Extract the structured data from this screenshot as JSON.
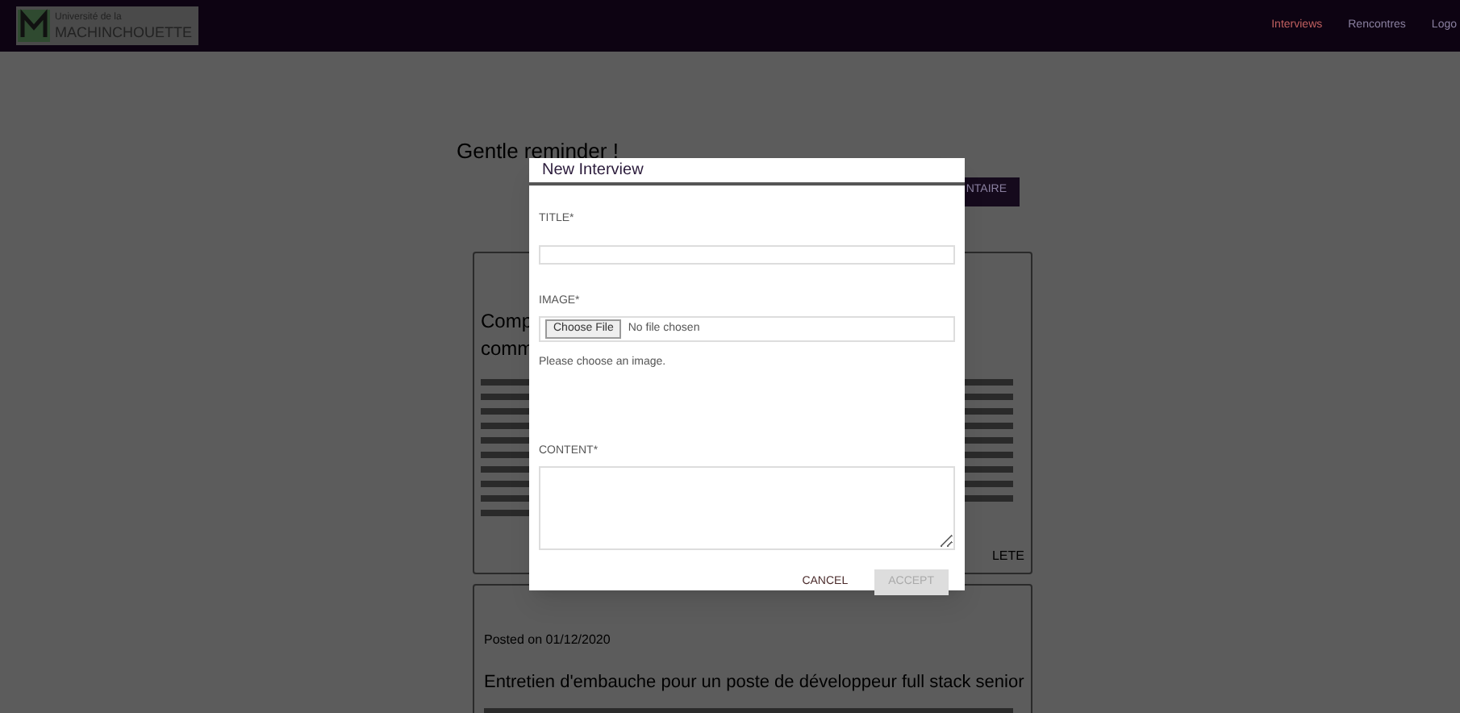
{
  "header": {
    "logo_line_1": "Université de la",
    "logo_line_2": "MACHINCHOUETTE",
    "nav": [
      {
        "label": "Interviews",
        "selected": true
      },
      {
        "label": "Rencontres",
        "selected": false
      },
      {
        "label": "Logo",
        "selected": false
      }
    ]
  },
  "page": {
    "title": "Gentle reminder !",
    "reminder_button": "NTAIRE",
    "cards": [
      {
        "title_lines": [
          "Comp",
          "comm"
        ],
        "action": "LETE"
      },
      {
        "meta": "Posted on 01/12/2020",
        "title": "Entretien d'embauche pour un poste de développeur full stack senior"
      }
    ]
  },
  "modal": {
    "title": "New Interview",
    "fields": [
      {
        "kind": "text",
        "label": "TITLE*"
      },
      {
        "kind": "file",
        "label": "IMAGE*",
        "button": "Choose File",
        "value": "No file chosen",
        "hint": "Please choose an image."
      },
      {
        "kind": "textarea",
        "label": "CONTENT*"
      }
    ],
    "buttons": [
      {
        "label": "CANCEL",
        "disabled": false
      },
      {
        "label": "ACCEPT",
        "disabled": true
      }
    ]
  }
}
